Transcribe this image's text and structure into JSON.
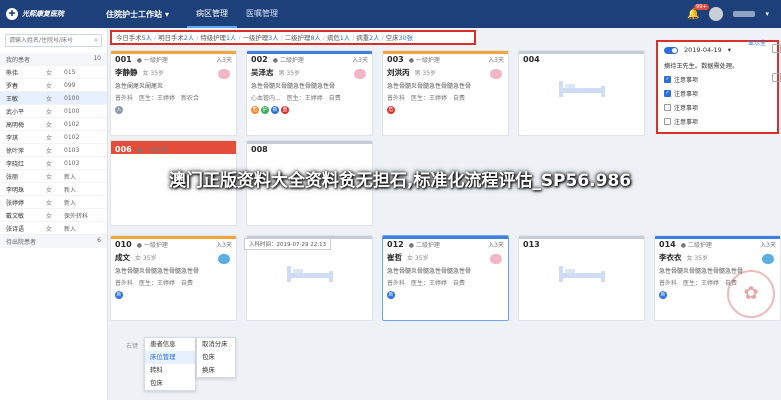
{
  "app": {
    "brand": "光熙康复医院",
    "title": "住院护士工作站",
    "nav": [
      "病区管理",
      "医嘱管理"
    ],
    "notif_count": "99+"
  },
  "sidebar": {
    "search_placeholder": "请输入姓名/住院号/床号",
    "section_in": "我的患者",
    "section_in_count": "10",
    "patients": [
      {
        "name": "熊伟",
        "sex": "女",
        "bed": "015"
      },
      {
        "name": "罗春",
        "sex": "女",
        "bed": "099"
      },
      {
        "name": "王敏",
        "sex": "女",
        "bed": "0100"
      },
      {
        "name": "武小平",
        "sex": "女",
        "bed": "0100"
      },
      {
        "name": "高明梅",
        "sex": "女",
        "bed": "0102"
      },
      {
        "name": "李琪",
        "sex": "女",
        "bed": "0102"
      },
      {
        "name": "徐叶萍",
        "sex": "女",
        "bed": "0103"
      },
      {
        "name": "李晓红",
        "sex": "女",
        "bed": "0103"
      },
      {
        "name": "张丽",
        "sex": "女",
        "bed": "新入"
      },
      {
        "name": "李明珠",
        "sex": "女",
        "bed": "新入"
      },
      {
        "name": "张婷婷",
        "sex": "女",
        "bed": "新入"
      },
      {
        "name": "戴文敏",
        "sex": "女",
        "bed": "保外转科"
      },
      {
        "name": "张诗语",
        "sex": "女",
        "bed": "新入"
      }
    ],
    "section_wait": "待出院患者",
    "section_wait_count": "6"
  },
  "summary": {
    "items": [
      {
        "label": "今日手术",
        "value": "5人"
      },
      {
        "label": "明日手术",
        "value": "2人"
      },
      {
        "label": "特级护理",
        "value": "1人"
      },
      {
        "label": "一级护理",
        "value": "3人"
      },
      {
        "label": "二级护理",
        "value": "8人"
      },
      {
        "label": "病危",
        "value": "1人"
      },
      {
        "label": "病重",
        "value": "2人"
      },
      {
        "label": "空床",
        "value": "30张"
      }
    ]
  },
  "cards": [
    {
      "bed": "001",
      "level": "一级护理",
      "days": "入3天",
      "name": "李静静",
      "info": "女 35岁",
      "diag": "急性阑尾炎阑尾炎",
      "dept": "普外科",
      "doctor": "医生：王婷婷",
      "note": "新农合"
    },
    {
      "bed": "002",
      "level": "二级护理",
      "days": "入3天",
      "name": "吴泽志",
      "info": "男 35岁",
      "diag": "急性骨髓炎骨髓急性骨髓急性骨",
      "dept": "心血管内...",
      "doctor": "医生：王婷婷",
      "note": "自费"
    },
    {
      "bed": "003",
      "level": "一级护理",
      "days": "入3天",
      "name": "刘洪丙",
      "info": "男 35岁",
      "diag": "急性骨髓炎骨髓急性骨髓急性骨",
      "dept": "普外科",
      "doctor": "医生：王婷婷",
      "note": "自费"
    },
    {
      "bed": "004"
    },
    {
      "bed": "006",
      "level": "一级护理"
    },
    {
      "bed": "008"
    },
    {
      "bed": "010",
      "level": "一级护理",
      "days": "入3天",
      "name": "成文",
      "info": "女 35岁",
      "diag": "急性骨髓炎骨髓急性骨髓急性骨",
      "dept": "普外科",
      "doctor": "医生：王婷婷",
      "note": "自费"
    },
    {
      "bed": "011"
    },
    {
      "bed": "012",
      "level": "二级护理",
      "days": "入3天",
      "name": "崔哲",
      "info": "女 35岁",
      "diag": "急性骨髓炎骨髓急性骨髓急性骨",
      "dept": "普外科",
      "doctor": "医生：王婷婷",
      "note": "自费"
    },
    {
      "bed": "013"
    },
    {
      "bed": "014",
      "level": "二级护理",
      "days": "入3天",
      "name": "李衣衣",
      "info": "女 35岁",
      "diag": "急性骨髓炎骨髓急性骨髓急性骨",
      "dept": "普外科",
      "doctor": "医生：王婷婷",
      "note": "自费"
    }
  ],
  "todo": {
    "date": "2019-04-19",
    "show_label": "显示全",
    "greeting": "摘待王先生。数据需处理。",
    "items": [
      "注意事项",
      "注意事项",
      "注意事项",
      "注意事项"
    ]
  },
  "tooltip": "入科时间：2019-07-29  22:13",
  "context_menu": {
    "hint": "右键",
    "menu1": [
      "患者信息",
      "床位管理",
      "转科",
      "包床"
    ],
    "menu2": [
      "取消分床",
      "包床",
      "换床"
    ]
  },
  "watermark": "澳门正版资料大全资料贫无担石,标准化流程评估_SP56.986",
  "colors": {
    "accent": "#2a6fdb",
    "header": "#1d3f7a",
    "alert": "#d9302c",
    "level1": "#f0a63a",
    "level2": "#3f7fe0"
  }
}
